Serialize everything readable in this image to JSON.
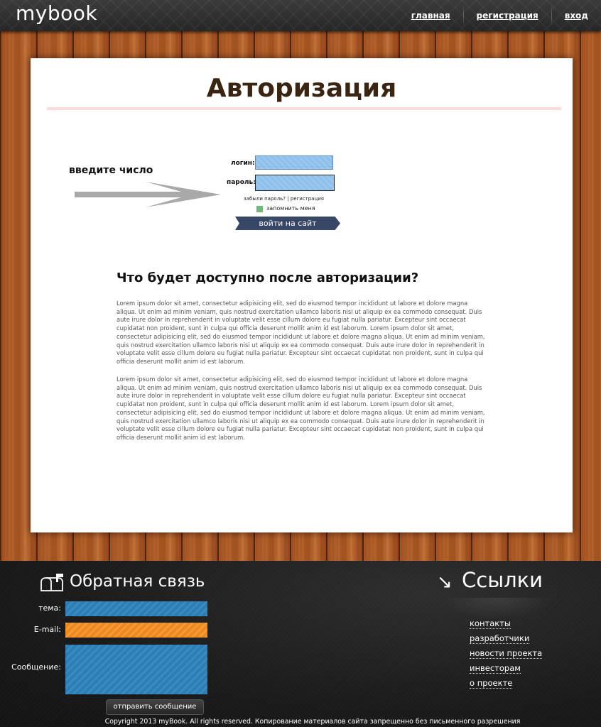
{
  "header": {
    "logo": "mybook",
    "nav": [
      "главная",
      "регистрация",
      "вход"
    ]
  },
  "auth": {
    "title": "Авторизация",
    "hint": "введите число",
    "login_label": "логин:",
    "password_label": "пароль:",
    "forgot_text": "забыли пароль?",
    "register_text": "регистрация",
    "remember_label": "запомнить меня",
    "submit_label": "войти на сайт"
  },
  "info": {
    "title": "Что будет доступно после авторизации?",
    "paragraphs": [
      "Lorem ipsum dolor sit amet, consectetur adipisicing elit, sed do eiusmod tempor incididunt ut labore et dolore magna aliqua. Ut enim ad minim veniam, quis nostrud exercitation ullamco laboris nisi ut aliquip ex ea commodo consequat. Duis aute irure dolor in reprehenderit in voluptate velit esse cillum dolore eu fugiat nulla pariatur. Excepteur sint occaecat cupidatat non proident, sunt in culpa qui officia deserunt mollit anim id est laborum. Lorem ipsum dolor sit amet, consectetur adipisicing elit, sed do eiusmod tempor incididunt ut labore et dolore magna aliqua. Ut enim ad minim veniam, quis nostrud exercitation ullamco laboris nisi ut aliquip ex ea commodo consequat. Duis aute irure dolor in reprehenderit in voluptate velit esse cillum dolore eu fugiat nulla pariatur. Excepteur sint occaecat cupidatat non proident, sunt in culpa qui officia deserunt mollit anim id est laborum.",
      "Lorem ipsum dolor sit amet, consectetur adipisicing elit, sed do eiusmod tempor incididunt ut labore et dolore magna aliqua. Ut enim ad minim veniam, quis nostrud exercitation ullamco laboris nisi ut aliquip ex ea commodo consequat. Duis aute irure dolor in reprehenderit in voluptate velit esse cillum dolore eu fugiat nulla pariatur. Excepteur sint occaecat cupidatat non proident, sunt in culpa qui officia deserunt mollit anim id est laborum. Lorem ipsum dolor sit amet, consectetur adipisicing elit, sed do eiusmod tempor incididunt ut labore et dolore magna aliqua. Ut enim ad minim veniam, quis nostrud exercitation ullamco laboris nisi ut aliquip ex ea commodo consequat. Duis aute irure dolor in reprehenderit in voluptate velit esse cillum dolore eu fugiat nulla pariatur. Excepteur sint occaecat cupidatat non proident, sunt in culpa qui officia deserunt mollit anim id est laborum."
    ]
  },
  "feedback": {
    "title": "Обратная связь",
    "subject_label": "тема:",
    "email_label": "E-mail:",
    "message_label": "Сообщение:",
    "send_label": "отправить сообщение"
  },
  "links": {
    "arrow": "↘",
    "title": "Ссылки",
    "items": [
      "контакты",
      "разработчики",
      "новости проекта",
      "инвесторам",
      "о проекте"
    ]
  },
  "footer": {
    "copyright": "Copyright 2013 myBook. All rights reserved. Копирование материалов сайта запрещенно без письменного разрешения"
  },
  "colors": {
    "panel_title": "#3a2412",
    "login_field": "#8fc0ec",
    "submit_button": "#394766",
    "remember_check": "#6dbb78",
    "feedback_blue": "#2d7fb8",
    "feedback_orange": "#f08a1e"
  }
}
